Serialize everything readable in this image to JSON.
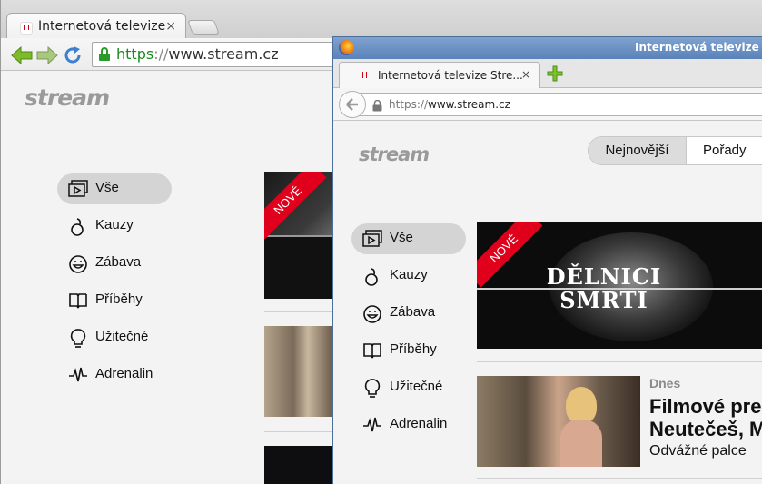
{
  "back_window": {
    "tab_title": "Internetová televize",
    "tab_close": "×",
    "url_scheme": "https",
    "url_sep": "://",
    "url_host": "www.stream.cz",
    "logo": "stream",
    "menu": [
      {
        "label": "Vše",
        "icon": "video-icon",
        "active": true
      },
      {
        "label": "Kauzy",
        "icon": "bomb-icon"
      },
      {
        "label": "Zábava",
        "icon": "smiley-icon"
      },
      {
        "label": "Příběhy",
        "icon": "book-icon"
      },
      {
        "label": "Užitečné",
        "icon": "bulb-icon"
      },
      {
        "label": "Adrenalin",
        "icon": "pulse-icon"
      }
    ],
    "ribbon": "NOVÉ"
  },
  "front_window": {
    "window_title": "Internetová televize S",
    "tab_title": "Internetová televize Stre...",
    "tab_close": "×",
    "url_scheme": "https://",
    "url_host": "www.stream.cz",
    "logo": "stream",
    "topnav": [
      "Nejnovější",
      "Pořady"
    ],
    "menu": [
      {
        "label": "Vše",
        "icon": "video-icon",
        "active": true
      },
      {
        "label": "Kauzy",
        "icon": "bomb-icon"
      },
      {
        "label": "Zábava",
        "icon": "smiley-icon"
      },
      {
        "label": "Příběhy",
        "icon": "book-icon"
      },
      {
        "label": "Užitečné",
        "icon": "bulb-icon"
      },
      {
        "label": "Adrenalin",
        "icon": "pulse-icon"
      }
    ],
    "feature": {
      "ribbon": "NOVÉ",
      "title_line1": "DĚLNICI",
      "title_line2": "SMRTI"
    },
    "article": {
      "date": "Dnes",
      "title_line1": "Filmové pre",
      "title_line2": "Neutečeš, M",
      "show": "Odvážné palce"
    }
  },
  "colors": {
    "accent_red": "#e0001b",
    "logo_gray": "#9a9a9a",
    "active_pill": "#d4d4d4",
    "secure_green": "#1a8a1a"
  }
}
